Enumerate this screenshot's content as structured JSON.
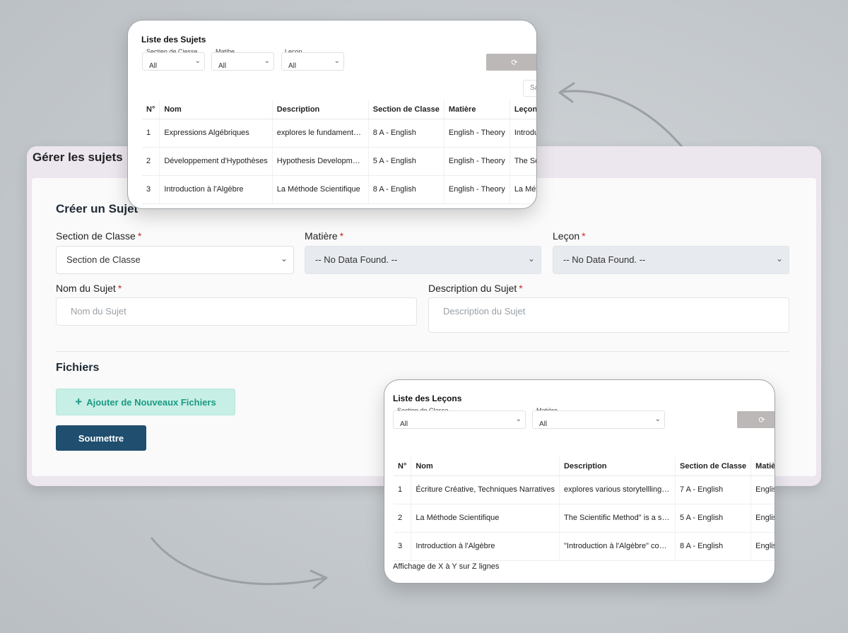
{
  "main": {
    "title": "Gérer les sujets",
    "form_heading": "Créer un Sujet",
    "fields": {
      "section_label": "Section de Classe",
      "section_value": "Section de Classe",
      "matiere_label": "Matière",
      "matiere_value": "-- No Data Found. --",
      "lecon_label": "Leçon",
      "lecon_value": "-- No Data Found. --",
      "nom_label": "Nom du Sujet",
      "nom_placeholder": "Nom du Sujet",
      "description_label": "Description du Sujet",
      "description_placeholder": "Description du Sujet",
      "required_mark": "*"
    },
    "files_heading": "Fichiers",
    "add_files_label": "Ajouter de Nouveaux Fichiers",
    "submit_label": "Soumettre"
  },
  "subjects_list": {
    "title": "Liste des Sujets",
    "filters": [
      {
        "label": "Sectien de Ciesse",
        "value": "All"
      },
      {
        "label": "Matibe",
        "value": "All"
      },
      {
        "label": "Leçon",
        "value": "All"
      }
    ],
    "search_stub": "Sa",
    "columns": [
      "N°",
      "Nom",
      "Description",
      "Section de Classe",
      "Matière",
      "Leçon"
    ],
    "rows": [
      [
        "1",
        "Expressions Algébriques",
        "explores le fundamental buil...",
        "8 A - English",
        "English - Theory",
        "Introduction to Algebra"
      ],
      [
        "2",
        "Développement d'Hypothèses",
        "Hypothesis Development is t...",
        "5 A - English",
        "English - Theory",
        "The Scientific Method"
      ],
      [
        "3",
        "Introduction à l'Algèbre",
        "La Méthode Scientifique",
        "8 A - English",
        "English - Theory",
        "La Méthode Scientifique"
      ]
    ]
  },
  "lessons_list": {
    "title": "Liste des Leçons",
    "filters": [
      {
        "label": "Section de Classe",
        "value": "All"
      },
      {
        "label": "Matière",
        "value": "All"
      }
    ],
    "columns": [
      "N°",
      "Nom",
      "Description",
      "Section de Classe",
      "Matière"
    ],
    "rows": [
      [
        "1",
        "Écriture Créative, Techniques Narratives",
        "explores various storytellling m...",
        "7 A - English",
        "English - Theory"
      ],
      [
        "2",
        "La Méthode Scientifique",
        "The Scientific Method\" is a syst...",
        "5 A - English",
        "English - Theory"
      ],
      [
        "3",
        "Introduction à l'Algèbre",
        "\"Introduction à l'Algèbre\" cove...",
        "8 A - English",
        "English - Theory"
      ]
    ],
    "footer": "Affichage de X à Y sur Z lignes"
  },
  "icons": {
    "refresh": "refresh-icon",
    "chevron": "chevron-down-icon",
    "plus": "plus-icon"
  },
  "colors": {
    "submit_bg": "#1f4e6e",
    "add_files_bg": "#c7efe6",
    "add_files_text": "#1b9a82",
    "required": "#c62828"
  }
}
